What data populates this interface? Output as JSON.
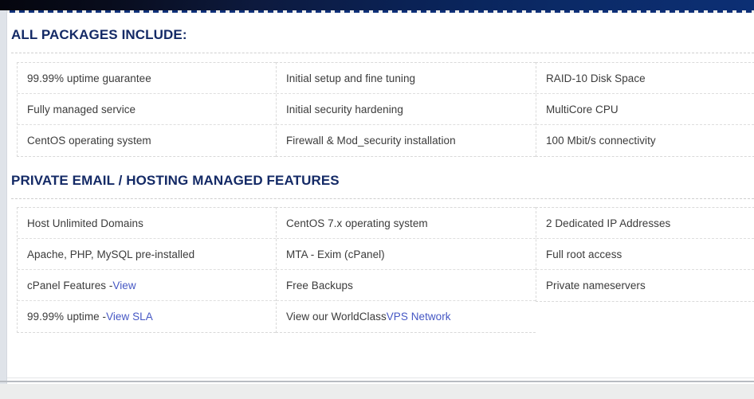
{
  "colors": {
    "banner_dark": "#05060e",
    "banner_navy": "#0c2f74",
    "heading": "#142a66",
    "body_text": "#3b3b3b",
    "link": "#4557c4",
    "cell_border": "#d9d9d9",
    "page_background": "#eceded",
    "panel_background": "#ffffff",
    "left_rail": "#dfe3e9"
  },
  "sections": [
    {
      "id": "all-packages",
      "title": "ALL PACKAGES INCLUDE:",
      "columns": [
        {
          "id": "col-1",
          "cells": [
            {
              "text": "99.99% uptime guarantee"
            },
            {
              "text": "Fully managed service"
            },
            {
              "text": "CentOS operating system"
            }
          ]
        },
        {
          "id": "col-2",
          "cells": [
            {
              "text": "Initial setup and fine tuning"
            },
            {
              "text": "Initial security hardening"
            },
            {
              "text": "Firewall & Mod_security installation"
            }
          ]
        },
        {
          "id": "col-3",
          "cells": [
            {
              "text": "RAID-10 Disk Space"
            },
            {
              "text": "MultiCore CPU"
            },
            {
              "text": "100 Mbit/s connectivity"
            }
          ]
        }
      ]
    },
    {
      "id": "private-email-hosting",
      "title": "PRIVATE EMAIL / HOSTING MANAGED FEATURES",
      "columns": [
        {
          "id": "col-1",
          "cells": [
            {
              "text": "Host Unlimited Domains"
            },
            {
              "text": "Apache, PHP, MySQL pre-installed"
            },
            {
              "text": "cPanel Features - ",
              "link": "View"
            },
            {
              "text": "99.99% uptime - ",
              "link": "View SLA"
            }
          ]
        },
        {
          "id": "col-2",
          "cells": [
            {
              "text": "CentOS 7.x operating system"
            },
            {
              "text": "MTA - Exim (cPanel)"
            },
            {
              "text": "Free Backups"
            },
            {
              "text": "View our WorldClass ",
              "link": "VPS Network"
            }
          ]
        },
        {
          "id": "col-3",
          "cells": [
            {
              "text": "2 Dedicated IP Addresses"
            },
            {
              "text": "Full root access"
            },
            {
              "text": "Private nameservers"
            }
          ]
        }
      ]
    }
  ]
}
